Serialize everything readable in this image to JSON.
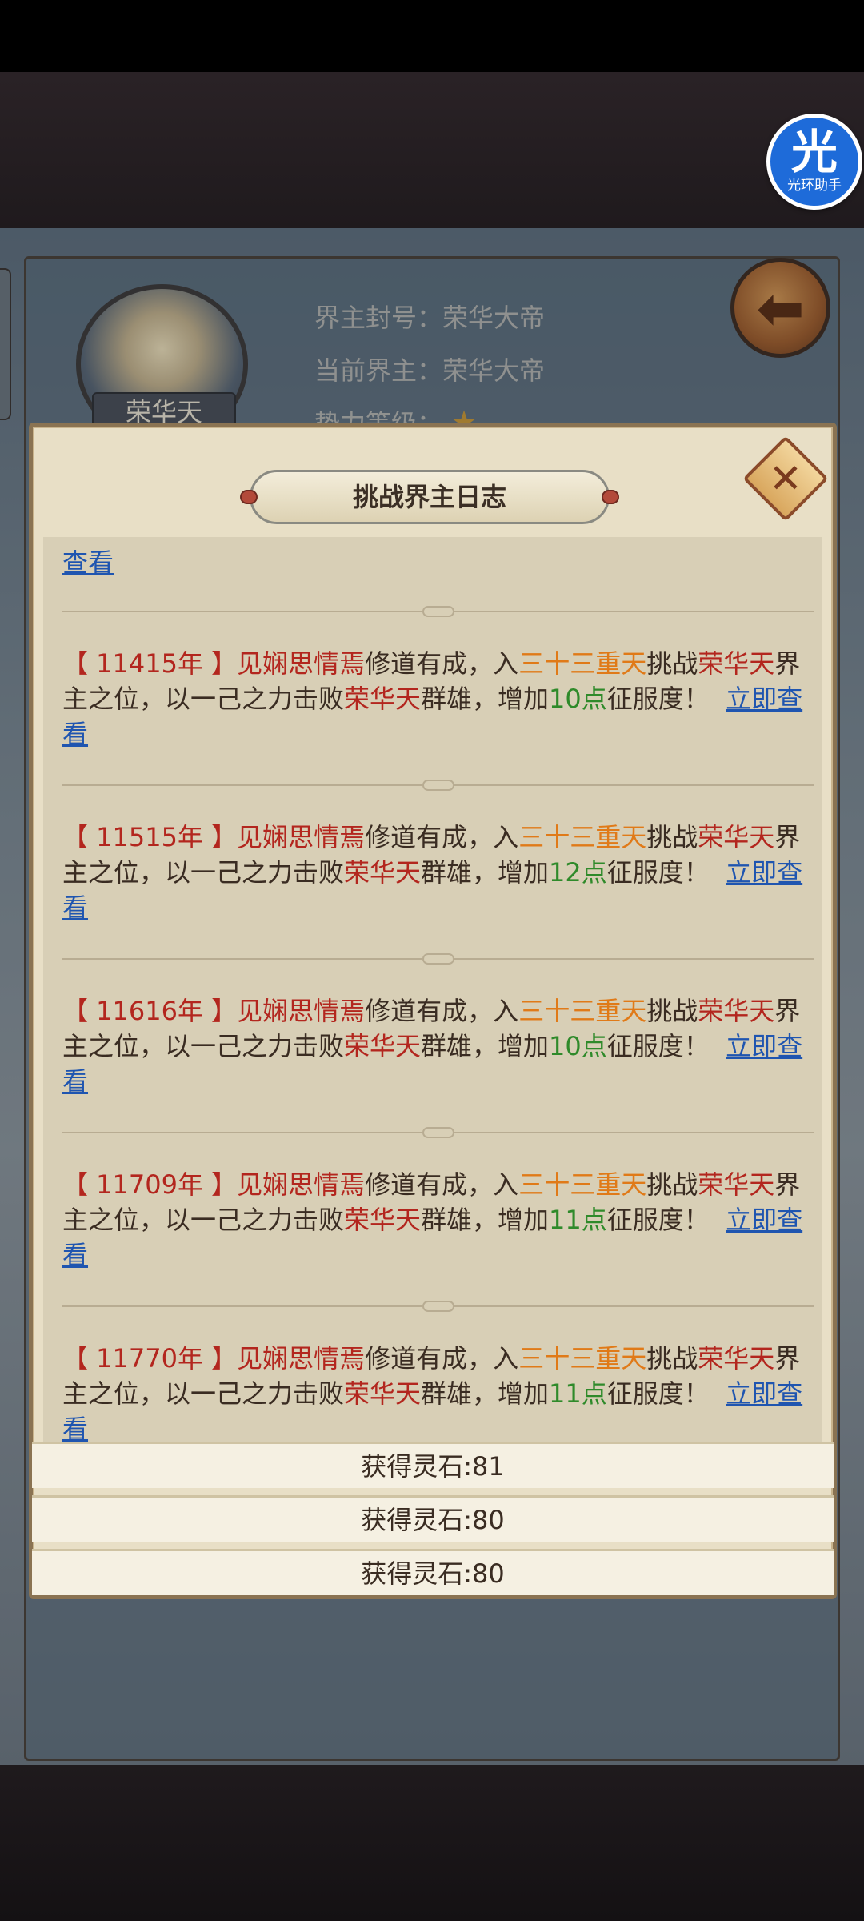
{
  "background": {
    "info": {
      "title_label": "界主封号：荣华大帝",
      "current_label": "当前界主：荣华大帝",
      "level_label": "势力等级："
    },
    "avatar_name": "荣华天"
  },
  "helper_badge": {
    "glyph": "光",
    "text": "光环助手"
  },
  "popup": {
    "title": "挑战界主日志",
    "top_link": "查看",
    "entries": [
      {
        "year": "【 11415年 】",
        "player": "见娴思情焉",
        "t1": "修道有成，入",
        "place": "三十三重天",
        "t2": "挑战",
        "realm": "荣华天",
        "t3": "界主之位，以一己之力击败",
        "realm2": "荣华天",
        "t4": "群雄，增加",
        "points": "10点",
        "t5": "征服度！",
        "link": "立即查看"
      },
      {
        "year": "【 11515年 】",
        "player": "见娴思情焉",
        "t1": "修道有成，入",
        "place": "三十三重天",
        "t2": "挑战",
        "realm": "荣华天",
        "t3": "界主之位，以一己之力击败",
        "realm2": "荣华天",
        "t4": "群雄，增加",
        "points": "12点",
        "t5": "征服度！",
        "link": "立即查看"
      },
      {
        "year": "【 11616年 】",
        "player": "见娴思情焉",
        "t1": "修道有成，入",
        "place": "三十三重天",
        "t2": "挑战",
        "realm": "荣华天",
        "t3": "界主之位，以一己之力击败",
        "realm2": "荣华天",
        "t4": "群雄，增加",
        "points": "10点",
        "t5": "征服度！",
        "link": "立即查看"
      },
      {
        "year": "【 11709年 】",
        "player": "见娴思情焉",
        "t1": "修道有成，入",
        "place": "三十三重天",
        "t2": "挑战",
        "realm": "荣华天",
        "t3": "界主之位，以一己之力击败",
        "realm2": "荣华天",
        "t4": "群雄，增加",
        "points": "11点",
        "t5": "征服度！",
        "link": "立即查看"
      },
      {
        "year": "【 11770年 】",
        "player": "见娴思情焉",
        "t1": "修道有成，入",
        "place": "三十三重天",
        "t2": "挑战",
        "realm": "荣华天",
        "t3": "界主之位，以一己之力击败",
        "realm2": "荣华天",
        "t4": "群雄，增加",
        "points": "11点",
        "t5": "征服度！",
        "link": "立即查看"
      }
    ],
    "rewards": [
      "获得灵石:81",
      "获得灵石:80",
      "获得灵石:80"
    ]
  }
}
